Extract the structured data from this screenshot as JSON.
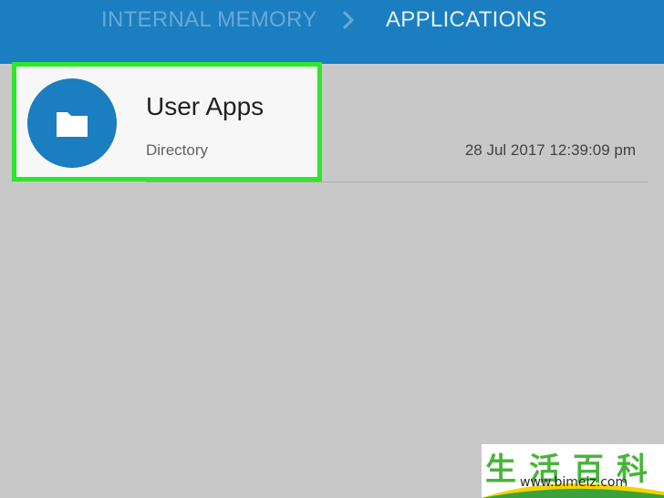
{
  "breadcrumb": {
    "items": [
      "INTERNAL MEMORY",
      "APPLICATIONS"
    ],
    "separator_icon": "chevron-right-icon"
  },
  "colors": {
    "topbar": "#1a7ec0",
    "highlight": "#2ee62a",
    "background": "#c8c8c8"
  },
  "list": {
    "items": [
      {
        "icon": "folder-icon",
        "title": "User Apps",
        "type": "Directory",
        "modified": "28 Jul 2017 12:39:09 pm"
      }
    ]
  },
  "watermark": {
    "chars": "生活百科",
    "url": "www.bimeiz.com"
  }
}
